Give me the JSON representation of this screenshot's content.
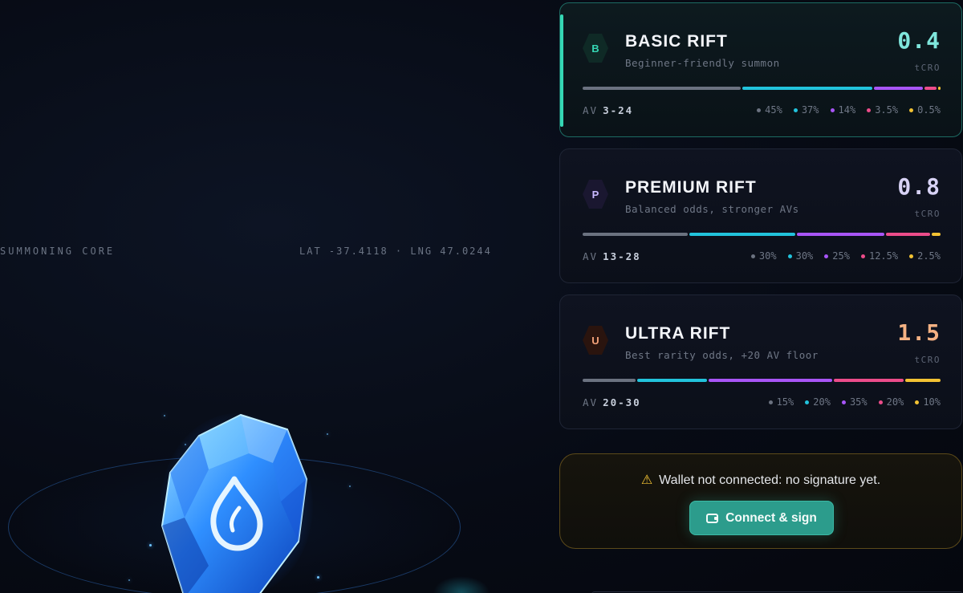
{
  "summon_panel": {
    "core_label": "SUMMONING CORE",
    "coords": "LAT -37.4118 · LNG 47.0244",
    "core_icon": "water-drop-crystal-icon"
  },
  "rifts": [
    {
      "badge": "B",
      "title": "BASIC RIFT",
      "description": "Beginner-friendly summon",
      "price": "0.4",
      "currency": "tCRO",
      "av_label": "AV",
      "av_range": "3-24",
      "price_color": "#7fe6dc",
      "selected": true,
      "odds": [
        {
          "tier": "common",
          "percent": 45,
          "label": "45%"
        },
        {
          "tier": "uncommon",
          "percent": 37,
          "label": "37%"
        },
        {
          "tier": "rare",
          "percent": 14,
          "label": "14%"
        },
        {
          "tier": "epic",
          "percent": 3.5,
          "label": "3.5%"
        },
        {
          "tier": "legendary",
          "percent": 0.5,
          "label": "0.5%"
        }
      ]
    },
    {
      "badge": "P",
      "title": "PREMIUM RIFT",
      "description": "Balanced odds, stronger AVs",
      "price": "0.8",
      "currency": "tCRO",
      "av_label": "AV",
      "av_range": "13-28",
      "price_color": "#d7d2f5",
      "selected": false,
      "odds": [
        {
          "tier": "common",
          "percent": 30,
          "label": "30%"
        },
        {
          "tier": "uncommon",
          "percent": 30,
          "label": "30%"
        },
        {
          "tier": "rare",
          "percent": 25,
          "label": "25%"
        },
        {
          "tier": "epic",
          "percent": 12.5,
          "label": "12.5%"
        },
        {
          "tier": "legendary",
          "percent": 2.5,
          "label": "2.5%"
        }
      ]
    },
    {
      "badge": "U",
      "title": "ULTRA RIFT",
      "description": "Best rarity odds, +20 AV floor",
      "price": "1.5",
      "currency": "tCRO",
      "av_label": "AV",
      "av_range": "20-30",
      "price_color": "#f4b183",
      "selected": false,
      "odds": [
        {
          "tier": "common",
          "percent": 15,
          "label": "15%"
        },
        {
          "tier": "uncommon",
          "percent": 20,
          "label": "20%"
        },
        {
          "tier": "rare",
          "percent": 35,
          "label": "35%"
        },
        {
          "tier": "epic",
          "percent": 20,
          "label": "20%"
        },
        {
          "tier": "legendary",
          "percent": 10,
          "label": "10%"
        }
      ]
    }
  ],
  "tier_colors": {
    "common": "#6b7280",
    "uncommon": "#22c3dc",
    "rare": "#a855f7",
    "epic": "#ec4c8a",
    "legendary": "#f2c233"
  },
  "wallet": {
    "warning_icon": "warning-triangle-icon",
    "message": "Wallet not connected: no signature yet.",
    "button_label": "Connect & sign",
    "button_icon": "wallet-icon"
  }
}
